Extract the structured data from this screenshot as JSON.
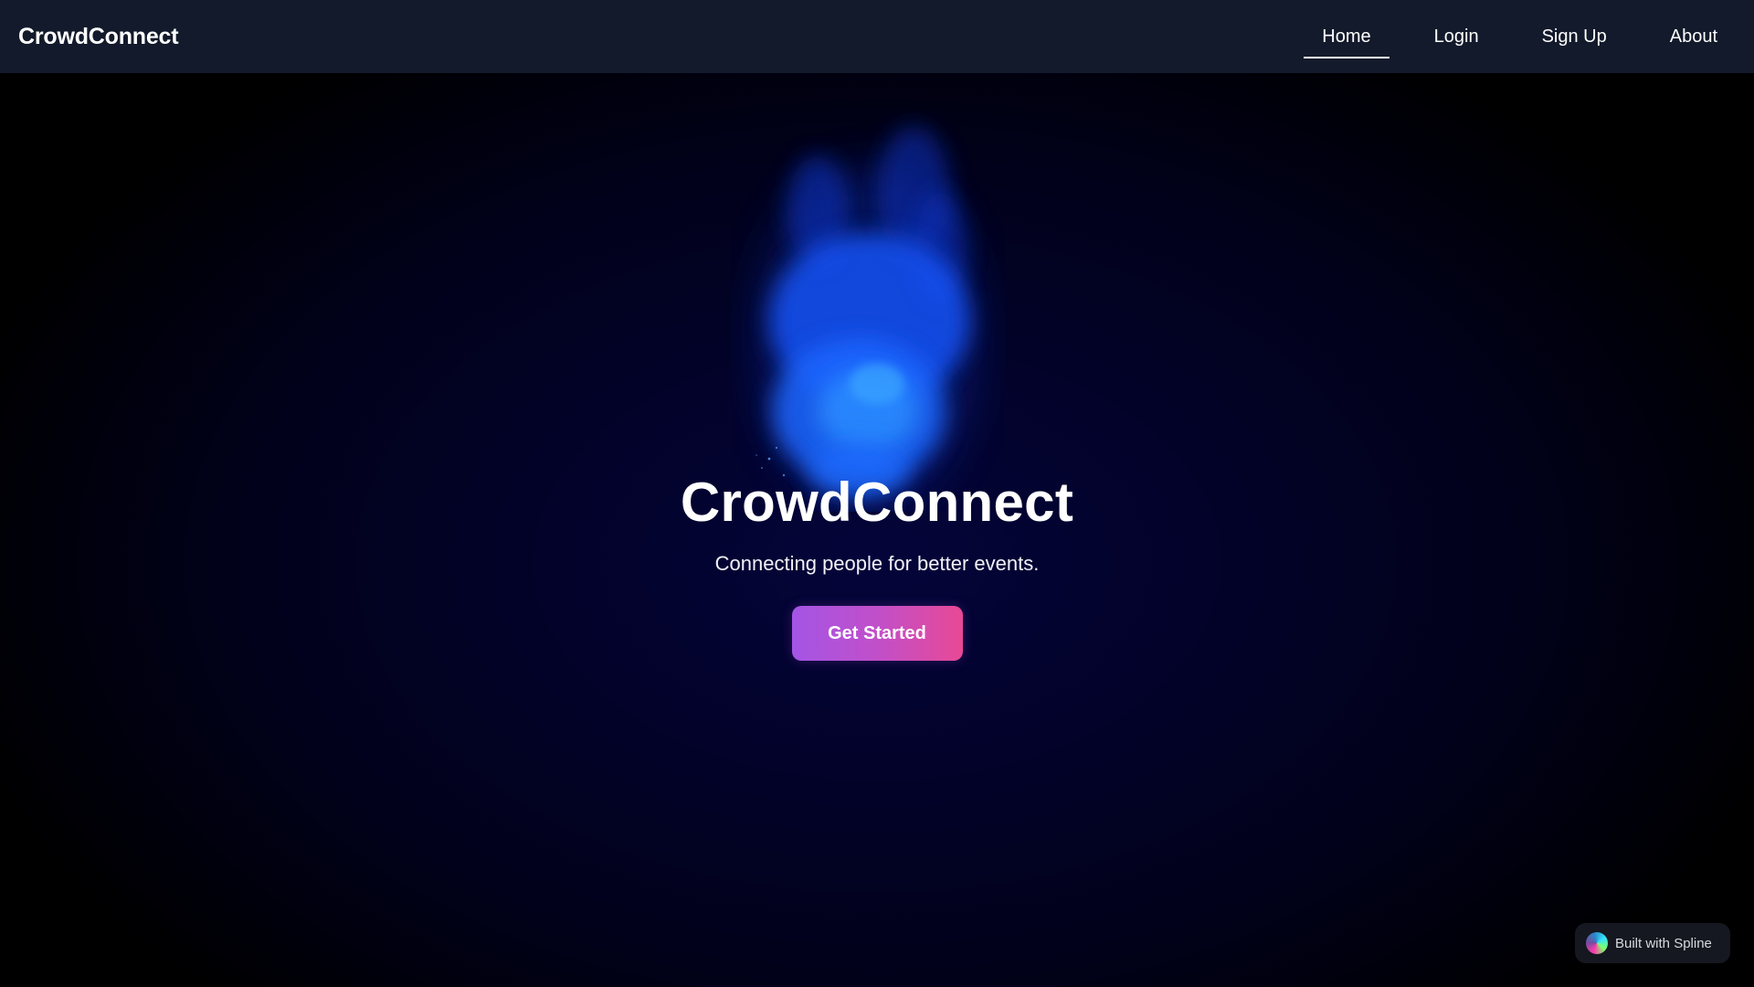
{
  "navbar": {
    "brand": "CrowdConnect",
    "links": [
      {
        "label": "Home",
        "active": true
      },
      {
        "label": "Login",
        "active": false
      },
      {
        "label": "Sign Up",
        "active": false
      },
      {
        "label": "About",
        "active": false
      }
    ]
  },
  "hero": {
    "title": "CrowdConnect",
    "subtitle": "Connecting people for better events.",
    "cta_label": "Get Started"
  },
  "badge": {
    "label": "Built with Spline",
    "icon": "spline-logo-icon"
  },
  "colors": {
    "navbar_bg": "#121a2b",
    "page_bg": "#020226",
    "flame": "#1e6bff",
    "cta_gradient_start": "#a455e6",
    "cta_gradient_end": "#e84995"
  },
  "scene": {
    "object": "blue-flame-3d"
  }
}
